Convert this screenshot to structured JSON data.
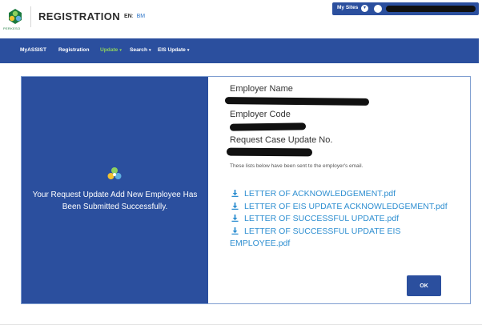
{
  "header": {
    "title": "REGISTRATION",
    "lang_en": "EN",
    "lang_bm": "BM",
    "logo_caption": "PERKESO",
    "my_sites_label": "My Sites"
  },
  "nav": {
    "items": [
      {
        "label": "MyASSIST",
        "dropdown": false,
        "active": false
      },
      {
        "label": "Registration",
        "dropdown": false,
        "active": false
      },
      {
        "label": "Update",
        "dropdown": true,
        "active": true
      },
      {
        "label": "Search",
        "dropdown": true,
        "active": false
      },
      {
        "label": "EIS Update",
        "dropdown": true,
        "active": false
      }
    ]
  },
  "left_panel": {
    "message": "Your Request Update Add New Employee Has Been Submitted Successfully."
  },
  "details": {
    "employer_name_label": "Employer Name",
    "employer_code_label": "Employer Code",
    "case_no_label": "Request Case Update No.",
    "note": "These lists below have been sent to the employer's email."
  },
  "documents": [
    "LETTER OF ACKNOWLEDGEMENT.pdf",
    "LETTER OF EIS UPDATE ACKNOWLEDGEMENT.pdf",
    "LETTER OF SUCCESSFUL UPDATE.pdf",
    "LETTER OF SUCCESSFUL UPDATE EIS EMPLOYEE.pdf"
  ],
  "ok_label": "OK",
  "colors": {
    "primary": "#2b4f9e",
    "link": "#2f8fd1",
    "nav_active": "#8ed15f",
    "logo_green": "#1b7a3e"
  }
}
